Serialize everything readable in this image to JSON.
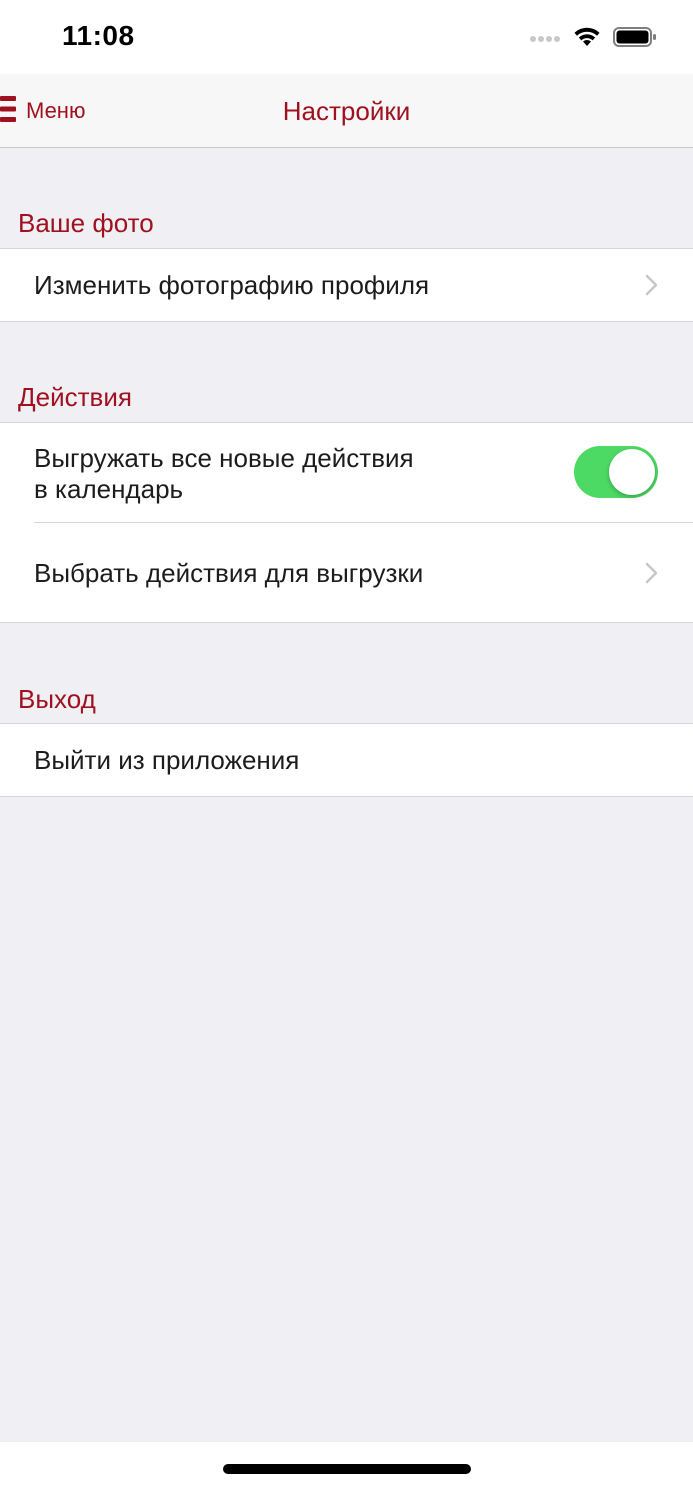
{
  "status_bar": {
    "time": "11:08",
    "icons": [
      "signal-dots-icon",
      "wifi-icon",
      "battery-icon"
    ]
  },
  "nav": {
    "menu_label": "Меню",
    "menu_icon": "hamburger-icon",
    "title": "Настройки"
  },
  "sections": {
    "photo": {
      "header": "Ваше фото",
      "change_photo": "Изменить фотографию профиля"
    },
    "actions": {
      "header": "Действия",
      "export_line1": "Выгружать все новые действия",
      "export_line2": "в календарь",
      "export_toggle_on": true,
      "select_actions": "Выбрать действия для выгрузки"
    },
    "logout": {
      "header": "Выход",
      "logout_label": "Выйти из приложения"
    }
  },
  "colors": {
    "accent": "#a0111f",
    "toggle_on": "#4cd964",
    "background": "#efeff4"
  }
}
